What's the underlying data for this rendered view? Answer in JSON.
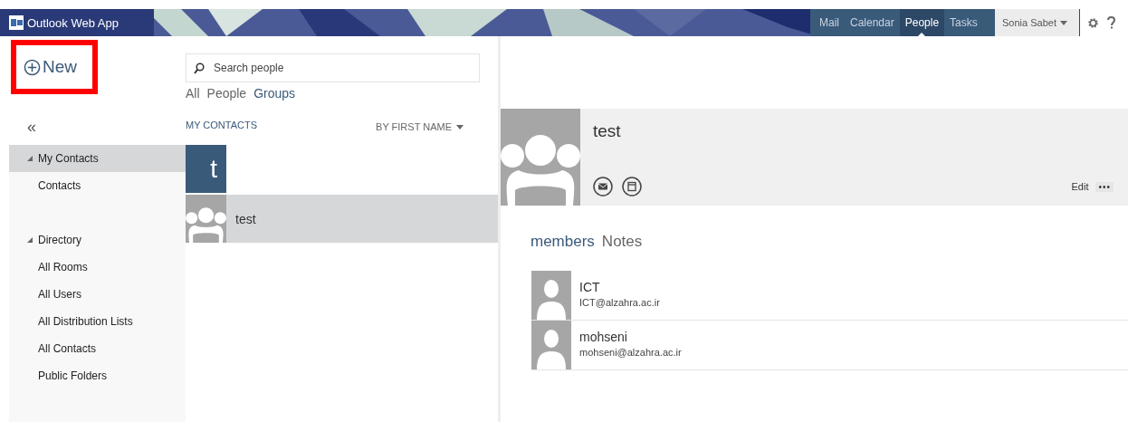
{
  "app": {
    "title": "Outlook Web App"
  },
  "nav_tabs": [
    {
      "label": "Mail",
      "selected": false
    },
    {
      "label": "Calendar",
      "selected": false
    },
    {
      "label": "People",
      "selected": true
    },
    {
      "label": "Tasks",
      "selected": false
    }
  ],
  "user": {
    "name": "Sonia Sabet"
  },
  "new_button": {
    "label": "New",
    "highlighted": true
  },
  "search": {
    "placeholder": "Search people"
  },
  "filters": [
    {
      "label": "All",
      "selected": false
    },
    {
      "label": "People",
      "selected": false
    },
    {
      "label": "Groups",
      "selected": true
    }
  ],
  "collapse_button": {
    "label": "«"
  },
  "sidebar": {
    "groups": [
      {
        "label": "My Contacts",
        "selected": true,
        "expanded": true,
        "children": [
          {
            "label": "Contacts",
            "selected": false
          }
        ]
      },
      {
        "label": "Directory",
        "selected": false,
        "expanded": true,
        "children": [
          {
            "label": "All Rooms",
            "selected": false
          },
          {
            "label": "All Users",
            "selected": false
          },
          {
            "label": "All Distribution Lists",
            "selected": false
          },
          {
            "label": "All Contacts",
            "selected": false
          },
          {
            "label": "Public Folders",
            "selected": false
          }
        ]
      }
    ]
  },
  "list": {
    "title": "MY CONTACTS",
    "sort": "BY FIRST NAME",
    "sections": [
      {
        "letter": "t",
        "items": [
          {
            "name": "test",
            "selected": true
          }
        ]
      }
    ]
  },
  "detail": {
    "name": "test",
    "edit": "Edit",
    "more": "•••",
    "tabs": [
      {
        "label": "members",
        "selected": true
      },
      {
        "label": "Notes",
        "selected": false
      }
    ],
    "members": [
      {
        "name": "ICT",
        "email": "ICT@alzahra.ac.ir"
      },
      {
        "name": "mohseni",
        "email": "mohseni@alzahra.ac.ir"
      }
    ]
  }
}
